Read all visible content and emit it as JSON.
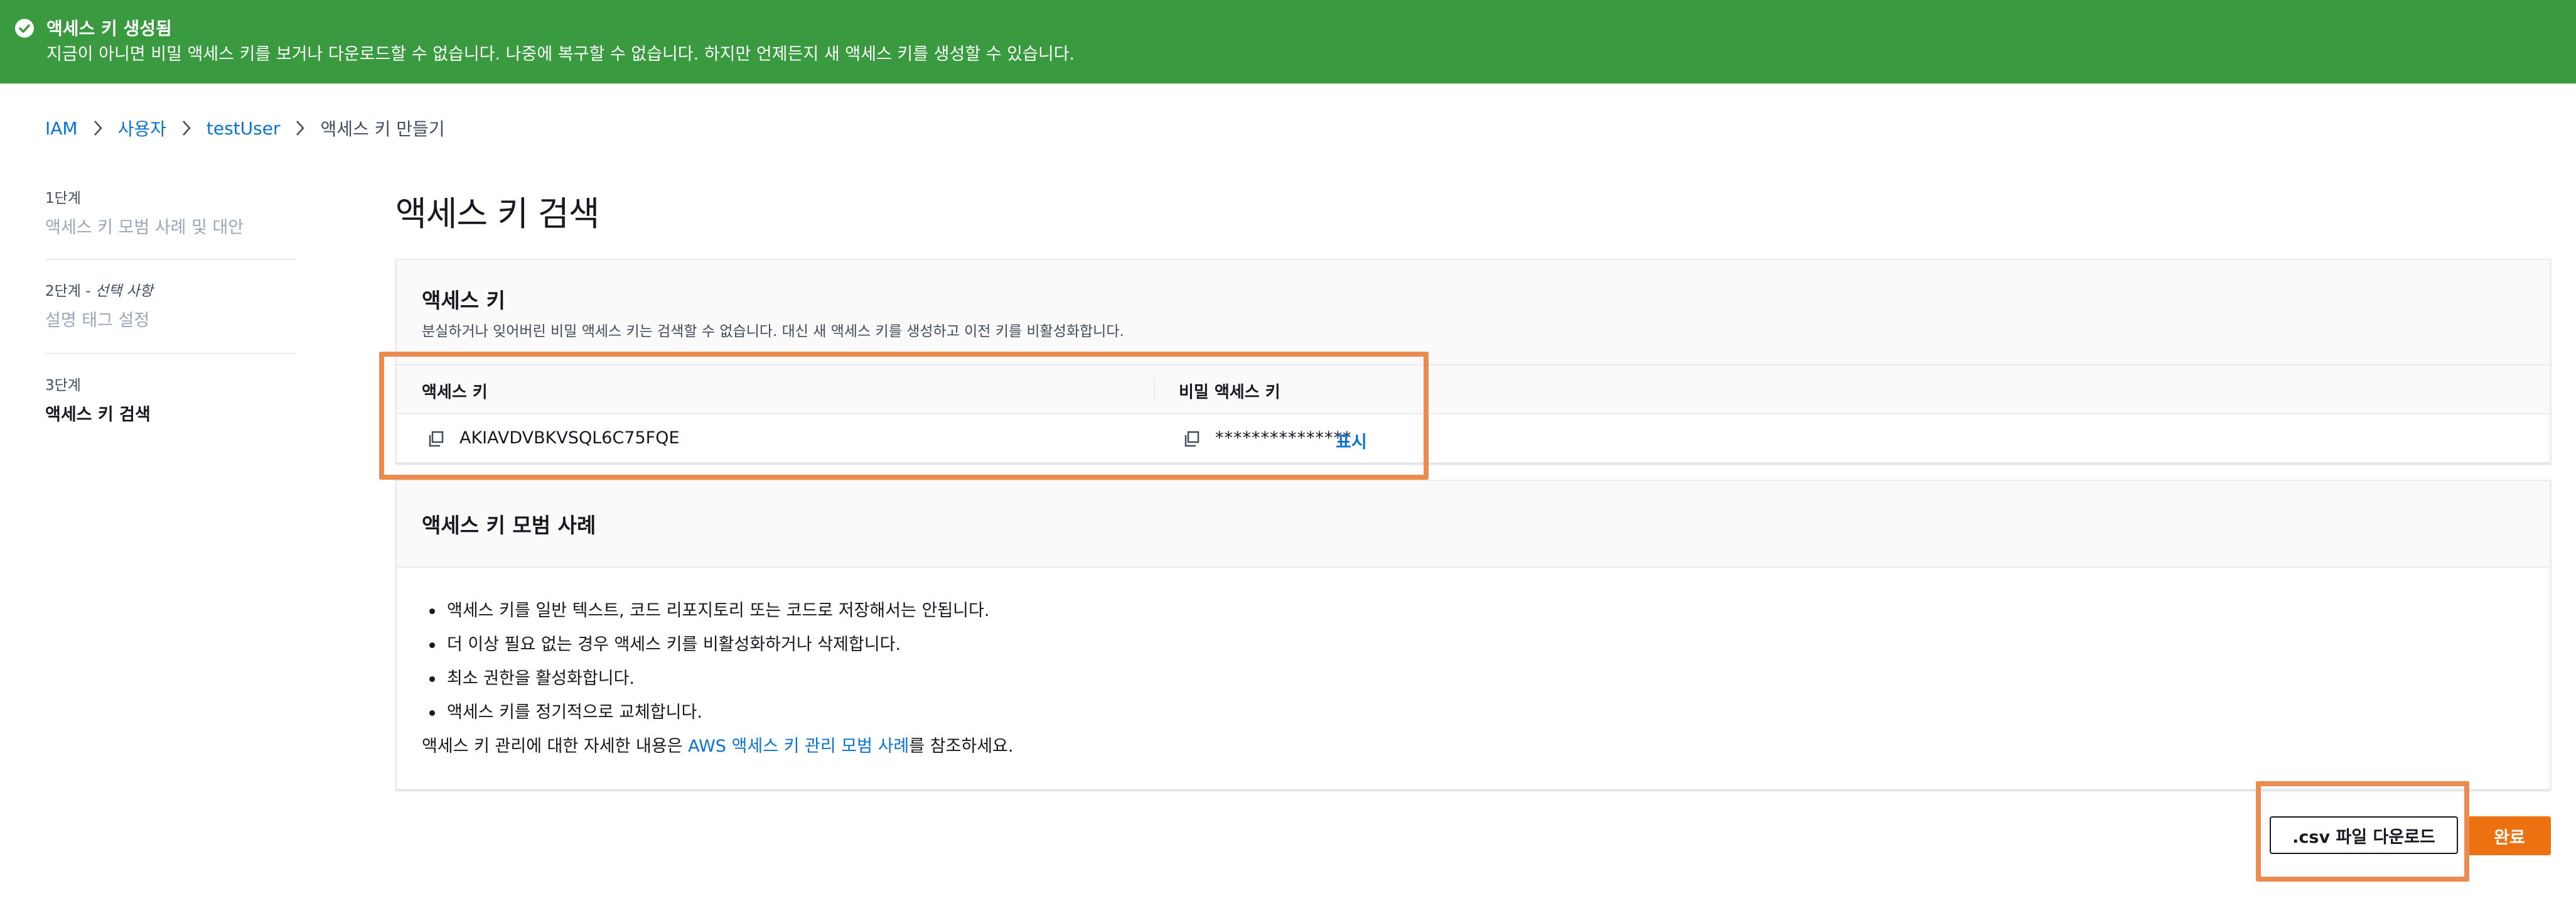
{
  "colors": {
    "banner_bg": "#3a9a40",
    "link": "#0972d3",
    "primary_button": "#ec7211",
    "annotation_box": "#ec8b50"
  },
  "banner": {
    "icon": "check-circle-icon",
    "title": "액세스 키 생성됨",
    "message": "지금이 아니면 비밀 액세스 키를 보거나 다운로드할 수 없습니다. 나중에 복구할 수 없습니다. 하지만 언제든지 새 액세스 키를 생성할 수 있습니다."
  },
  "breadcrumb": {
    "items": [
      "IAM",
      "사용자",
      "testUser",
      "액세스 키 만들기"
    ],
    "separator_icon": "chevron-right-icon"
  },
  "steps": [
    {
      "number": "1단계",
      "optional": "",
      "title": "액세스 키 모범 사례 및 대안",
      "active": false
    },
    {
      "number": "2단계",
      "optional": "선택 사항",
      "title": "설명 태그 설정",
      "active": false
    },
    {
      "number": "3단계",
      "optional": "",
      "title": "액세스 키 검색",
      "active": true
    }
  ],
  "page_title": "액세스 키 검색",
  "access_key_panel": {
    "title": "액세스 키",
    "description": "분실하거나 잊어버린 비밀 액세스 키는 검색할 수 없습니다. 대신 새 액세스 키를 생성하고 이전 키를 비활성화합니다.",
    "columns": [
      "액세스 키",
      "비밀 액세스 키"
    ],
    "access_key_value": "AKIAVDVBKVSQL6C75FQE",
    "secret_key_masked": "***************",
    "show_label": "표시",
    "copy_icon": "copy-icon"
  },
  "best_practices_panel": {
    "title": "액세스 키 모범 사례",
    "items": [
      "액세스 키를 일반 텍스트, 코드 리포지토리 또는 코드로 저장해서는 안됩니다.",
      "더 이상 필요 없는 경우 액세스 키를 비활성화하거나 삭제합니다.",
      "최소 권한을 활성화합니다.",
      "액세스 키를 정기적으로 교체합니다."
    ],
    "reference_prefix": "액세스 키 관리에 대한 자세한 내용은 ",
    "reference_link": "AWS 액세스 키 관리 모범 사례",
    "reference_suffix": "를 참조하세요."
  },
  "buttons": {
    "download_csv": ".csv 파일 다운로드",
    "done": "완료"
  }
}
